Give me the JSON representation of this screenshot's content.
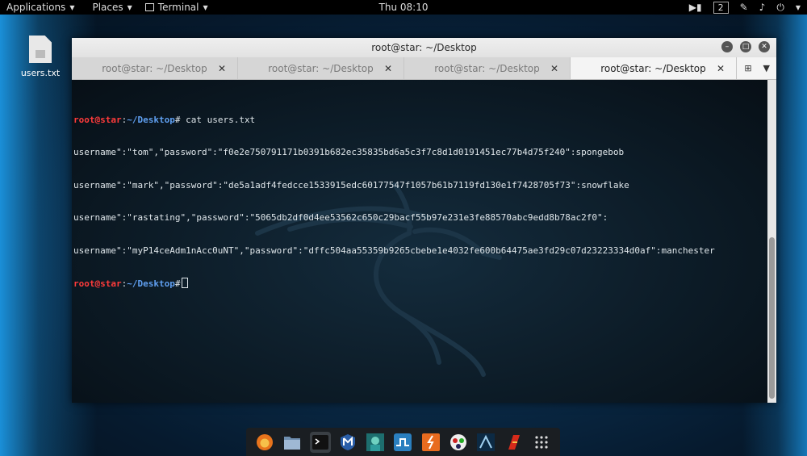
{
  "topbar": {
    "applications": "Applications",
    "places": "Places",
    "terminal": "Terminal",
    "clock": "Thu 08:10",
    "workspace": "2"
  },
  "desktop": {
    "file_label": "users.txt"
  },
  "window": {
    "title": "root@star: ~/Desktop",
    "tabs": [
      {
        "label": "root@star: ~/Desktop",
        "active": false
      },
      {
        "label": "root@star: ~/Desktop",
        "active": false
      },
      {
        "label": "root@star: ~/Desktop",
        "active": false
      },
      {
        "label": "root@star: ~/Desktop",
        "active": true
      }
    ]
  },
  "terminal": {
    "prompt_user": "root@star",
    "prompt_colon": ":",
    "prompt_path": "~/Desktop",
    "prompt_hash": "#",
    "command": " cat users.txt",
    "output": [
      "username\":\"tom\",\"password\":\"f0e2e750791171b0391b682ec35835bd6a5c3f7c8d1d0191451ec77b4d75f240\":spongebob",
      "username\":\"mark\",\"password\":\"de5a1adf4fedcce1533915edc60177547f1057b61b7119fd130e1f7428705f73\":snowflake",
      "username\":\"rastating\",\"password\":\"5065db2df0d4ee53562c650c29bacf55b97e231e3fe88570abc9edd8b78ac2f0\":",
      "username\":\"myP14ceAdm1nAcc0uNT\",\"password\":\"dffc504aa55359b9265cbebe1e4032fe600b64475ae3fd29c07d23223334d0af\":manchester"
    ]
  },
  "dock": {
    "items": [
      {
        "icon": "firefox-icon"
      },
      {
        "icon": "files-icon"
      },
      {
        "icon": "terminal-icon",
        "active": true
      },
      {
        "icon": "metasploit-icon"
      },
      {
        "icon": "armitage-icon"
      },
      {
        "icon": "burpsuite-icon"
      },
      {
        "icon": "wireshark-icon"
      },
      {
        "icon": "beef-icon"
      },
      {
        "icon": "maltego-icon"
      },
      {
        "icon": "faraday-icon"
      },
      {
        "icon": "app-grid-icon"
      }
    ]
  }
}
